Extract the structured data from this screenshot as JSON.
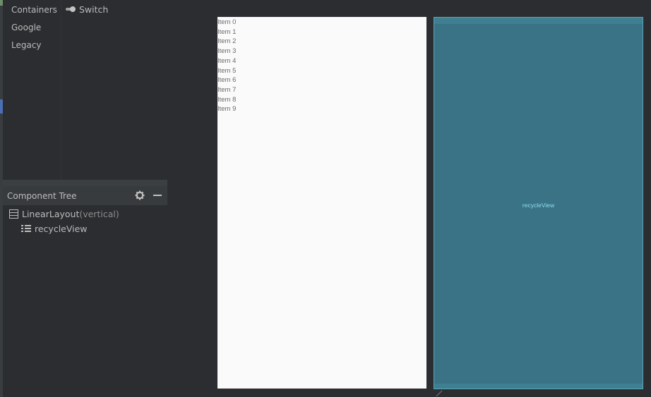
{
  "palette": {
    "categories": [
      "Containers",
      "Google",
      "Legacy"
    ],
    "widget": {
      "label": "Switch",
      "icon": "switch-icon"
    }
  },
  "component_tree": {
    "title": "Component Tree",
    "icons": {
      "settings": "gear-icon",
      "minimize": "minimize-icon"
    },
    "nodes": [
      {
        "name": "LinearLayout",
        "detail": "(vertical)",
        "icon": "linear-layout-icon"
      },
      {
        "name": "recycleView",
        "detail": "",
        "icon": "recycler-view-icon"
      }
    ]
  },
  "design_preview": {
    "items": [
      "Item 0",
      "Item 1",
      "Item 2",
      "Item 3",
      "Item 4",
      "Item 5",
      "Item 6",
      "Item 7",
      "Item 8",
      "Item 9"
    ]
  },
  "blueprint_preview": {
    "label": "recycleView"
  },
  "colors": {
    "background": "#2b2d30",
    "blueprint": "#3a7385",
    "blueprint_text": "#8fdcf0",
    "selection": "#4a6fb5"
  }
}
